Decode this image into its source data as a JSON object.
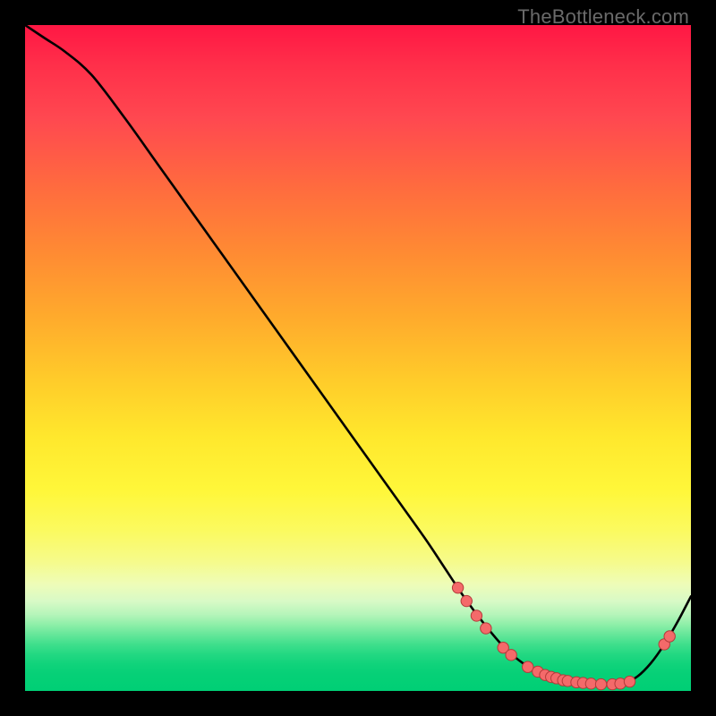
{
  "watermark": "TheBottleneck.com",
  "colors": {
    "curve": "#000000",
    "marker_fill": "#f46a6a",
    "marker_stroke": "#b43a3a",
    "background": "#000000"
  },
  "chart_data": {
    "type": "line",
    "title": "",
    "xlabel": "",
    "ylabel": "",
    "xlim": [
      0,
      100
    ],
    "ylim": [
      0,
      100
    ],
    "grid": false,
    "legend": false,
    "curve_note": "y is percentage height (100 = top). Curve descends steeply from top-left, flattens near zero around x≈73–90, then rises.",
    "x": [
      0,
      3,
      6,
      10,
      15,
      20,
      25,
      30,
      35,
      40,
      45,
      50,
      55,
      60,
      63,
      66,
      69,
      72,
      75,
      78,
      81,
      84,
      87,
      90,
      92,
      94,
      96,
      98,
      100
    ],
    "y": [
      100,
      98,
      96,
      92.5,
      86,
      79,
      72,
      65,
      58,
      51,
      44,
      37,
      30,
      23,
      18.5,
      14,
      10,
      6.5,
      4,
      2.4,
      1.5,
      1.1,
      1.0,
      1.2,
      2.2,
      4.2,
      7.0,
      10.4,
      14.2
    ],
    "markers_note": "Highlighted points along the valley segment (pink dots).",
    "markers": [
      {
        "x": 65.0,
        "y": 15.5
      },
      {
        "x": 66.3,
        "y": 13.5
      },
      {
        "x": 67.8,
        "y": 11.3
      },
      {
        "x": 69.2,
        "y": 9.4
      },
      {
        "x": 71.8,
        "y": 6.5
      },
      {
        "x": 73.0,
        "y": 5.4
      },
      {
        "x": 75.5,
        "y": 3.6
      },
      {
        "x": 77.0,
        "y": 2.9
      },
      {
        "x": 78.1,
        "y": 2.4
      },
      {
        "x": 79.0,
        "y": 2.1
      },
      {
        "x": 79.8,
        "y": 1.9
      },
      {
        "x": 80.8,
        "y": 1.6
      },
      {
        "x": 81.5,
        "y": 1.5
      },
      {
        "x": 82.8,
        "y": 1.3
      },
      {
        "x": 83.8,
        "y": 1.2
      },
      {
        "x": 85.0,
        "y": 1.1
      },
      {
        "x": 86.5,
        "y": 1.0
      },
      {
        "x": 88.2,
        "y": 1.0
      },
      {
        "x": 89.4,
        "y": 1.1
      },
      {
        "x": 90.8,
        "y": 1.4
      },
      {
        "x": 96.0,
        "y": 7.0
      },
      {
        "x": 96.8,
        "y": 8.2
      }
    ]
  }
}
